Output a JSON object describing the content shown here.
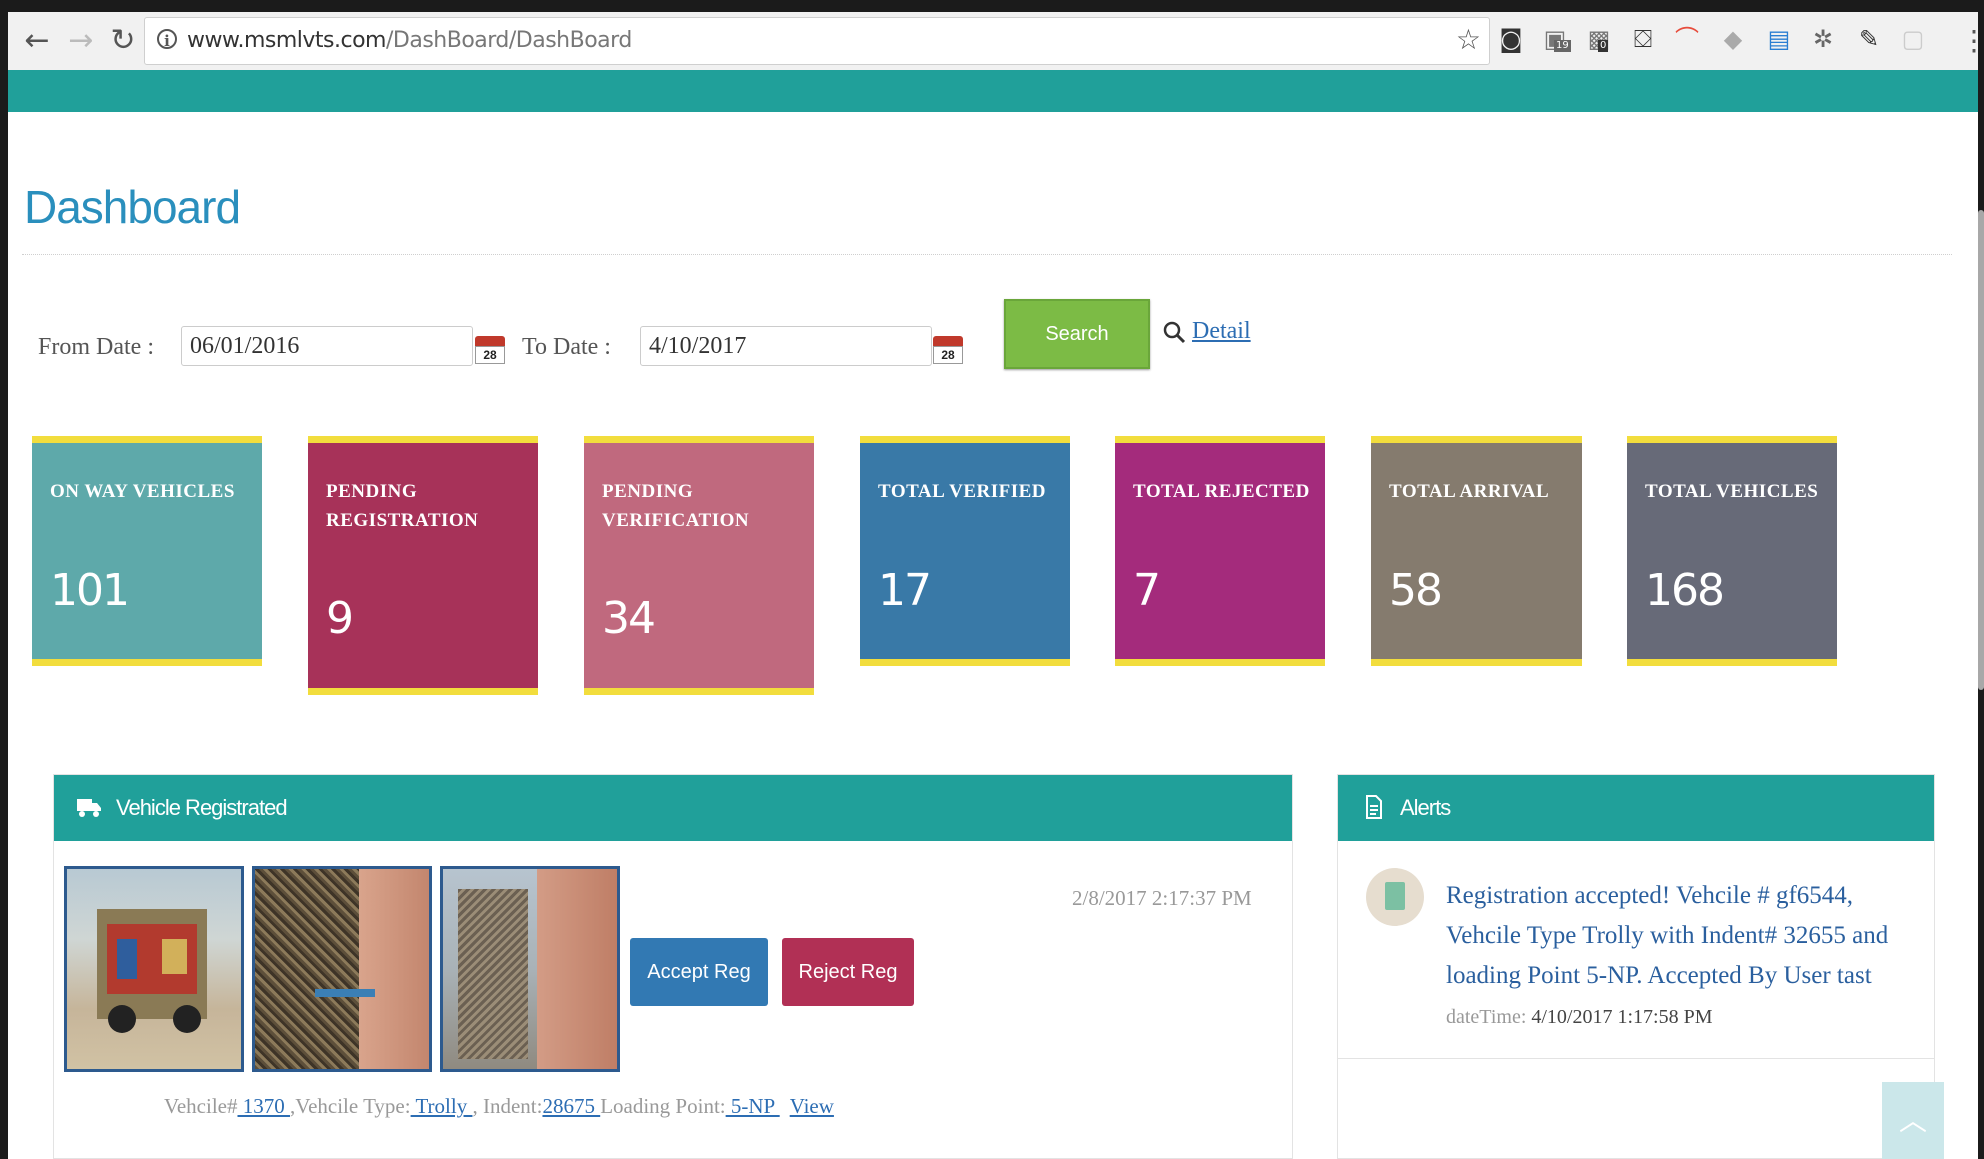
{
  "browser": {
    "url_domain": "www.msmlvts.com",
    "url_path": "/DashBoard/DashBoard",
    "ext_badges": [
      "19",
      "0"
    ]
  },
  "page": {
    "title": "Dashboard"
  },
  "filters": {
    "from_label": "From Date :",
    "from_value": "06/01/2016",
    "to_label": "To Date :",
    "to_value": "4/10/2017",
    "calendar_day": "28",
    "search_label": "Search",
    "detail_label": "Detail"
  },
  "tiles": [
    {
      "label": "ON WAY VEHICLES",
      "value": "101",
      "color": "#5ea9aa"
    },
    {
      "label": "PENDING REGISTRATION",
      "value": "9",
      "color": "#a73259"
    },
    {
      "label": "PENDING VERIFICATION",
      "value": "34",
      "color": "#c0697e"
    },
    {
      "label": "TOTAL VERIFIED",
      "value": "17",
      "color": "#3979a7"
    },
    {
      "label": "TOTAL REJECTED",
      "value": "7",
      "color": "#a42b7c"
    },
    {
      "label": "TOTAL ARRIVAL",
      "value": "58",
      "color": "#857b6e"
    },
    {
      "label": "TOTAL VEHICLES",
      "value": "168",
      "color": "#676a78"
    }
  ],
  "vehicle_panel": {
    "title": "Vehicle Registrated",
    "timestamp": "2/8/2017 2:17:37 PM",
    "accept_label": "Accept Reg",
    "reject_label": "Reject Reg",
    "info": {
      "vehicle_prefix": "Vehcile#",
      "vehicle_no": " 1370 ",
      "type_prefix": ",Vehcile Type:",
      "type": " Trolly ",
      "indent_prefix": ", Indent:",
      "indent": "28675 ",
      "loading_prefix": "Loading Point:",
      "loading": " 5-NP ",
      "view_label": "View"
    }
  },
  "alerts_panel": {
    "title": "Alerts",
    "message": "Registration accepted! Vehcile # gf6544, Vehcile Type Trolly with Indent# 32655 and loading Point 5-NP. Accepted By User tast",
    "time_label": "dateTime:",
    "time_value": "4/10/2017 1:17:58 PM"
  },
  "colors": {
    "teal": "#20a09a",
    "accent_blue": "#2a8fbd",
    "tile_border": "#f2dd3d"
  }
}
